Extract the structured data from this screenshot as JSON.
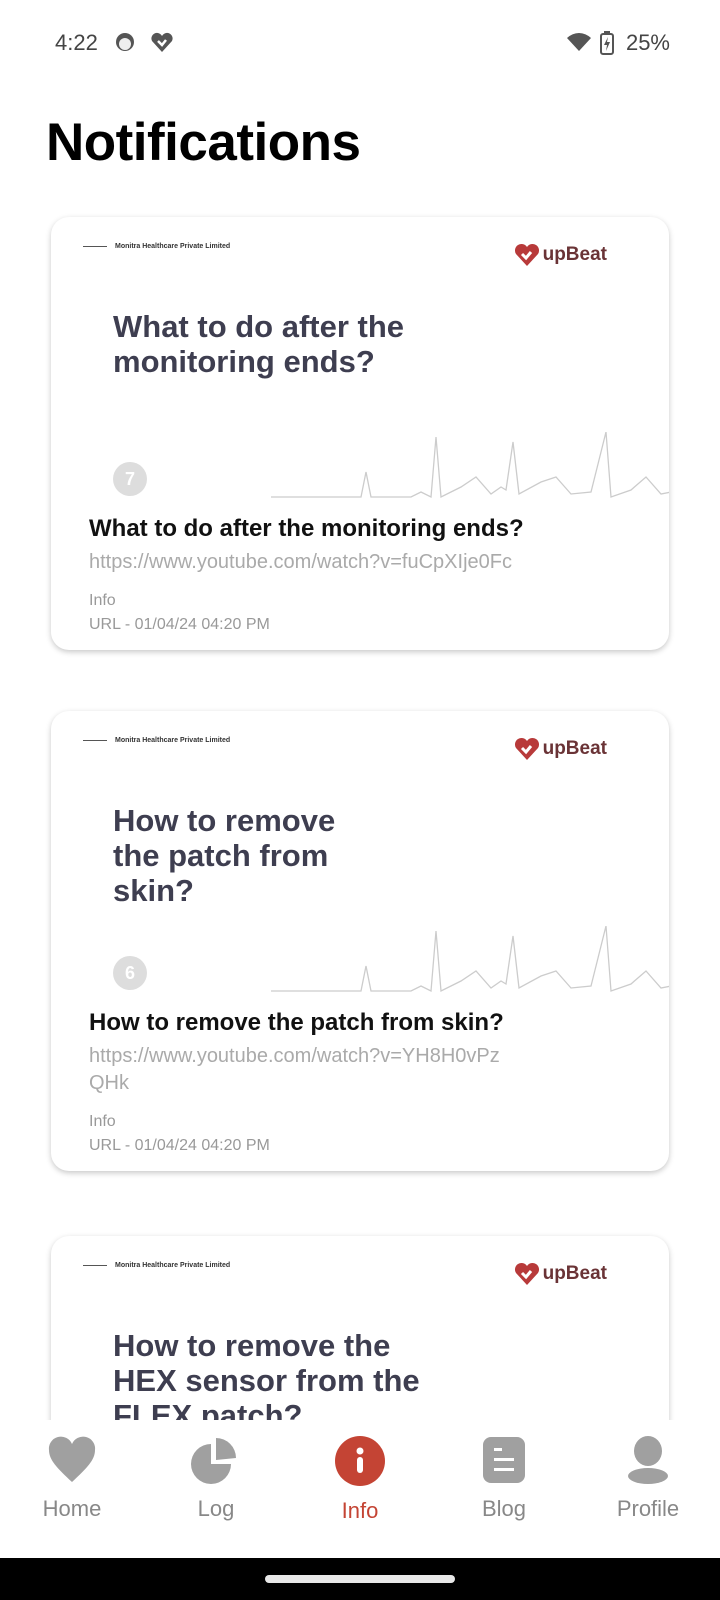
{
  "status_bar": {
    "time": "4:22",
    "battery": "25%",
    "icons": [
      "face-icon",
      "heart-app-icon",
      "wifi-icon",
      "battery-charging-icon"
    ]
  },
  "page_title": "Notifications",
  "notifications": [
    {
      "thumb_company": "Monitra Healthcare Private Limited",
      "thumb_brand": "upBeat",
      "thumb_title": "What to do after the monitoring ends?",
      "thumb_number": "7",
      "title": "What to do after the monitoring ends?",
      "url": "https://www.youtube.com/watch?v=fuCpXIje0Fc",
      "type": "Info",
      "meta": "URL - 01/04/24 04:20 PM"
    },
    {
      "thumb_company": "Monitra Healthcare Private Limited",
      "thumb_brand": "upBeat",
      "thumb_title": "How to remove the patch from skin?",
      "thumb_number": "6",
      "title": "How to remove the patch from skin?",
      "url": "https://www.youtube.com/watch?v=YH8H0vPzQHk",
      "type": "Info",
      "meta": "URL - 01/04/24 04:20 PM"
    },
    {
      "thumb_company": "Monitra Healthcare Private Limited",
      "thumb_brand": "upBeat",
      "thumb_title": "How to remove the HEX sensor from the FLEX patch?"
    }
  ],
  "nav": {
    "items": [
      {
        "label": "Home",
        "icon": "heart-icon"
      },
      {
        "label": "Log",
        "icon": "pie-chart-icon"
      },
      {
        "label": "Info",
        "icon": "info-icon",
        "active": true
      },
      {
        "label": "Blog",
        "icon": "document-icon"
      },
      {
        "label": "Profile",
        "icon": "person-icon"
      }
    ]
  },
  "colors": {
    "accent": "#c44434",
    "inactive": "#a0a0a0",
    "brand": "#b83a3a"
  }
}
